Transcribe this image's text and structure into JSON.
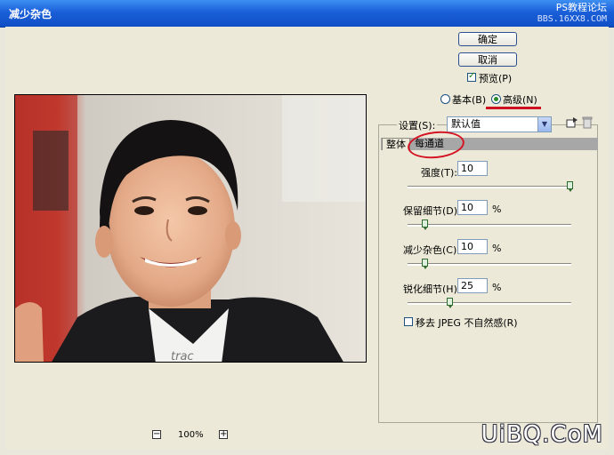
{
  "window": {
    "title": "减少杂色",
    "watermark_top_line1": "PS教程论坛",
    "watermark_top_line2": "BBS.16XX8.COM"
  },
  "buttons": {
    "ok": "确定",
    "cancel": "取消"
  },
  "preview": {
    "label": "预览(P)",
    "checked": true
  },
  "mode": {
    "basic_label": "基本(B)",
    "advanced_label": "高级(N)",
    "selected": "advanced"
  },
  "settings": {
    "label": "设置(S):",
    "value": "默认值"
  },
  "tabs": [
    {
      "label": "整体"
    },
    {
      "label": "每通道"
    }
  ],
  "controls": {
    "strength": {
      "label": "强度(T):",
      "value": "10",
      "level_fraction": 1.0
    },
    "preserve_details": {
      "label": "保留细节(D):",
      "value": "10",
      "unit": "%",
      "level_fraction": 0.1
    },
    "reduce_color_noise": {
      "label": "减少杂色(C):",
      "value": "10",
      "unit": "%",
      "level_fraction": 0.1
    },
    "sharpen_details": {
      "label": "锐化细节(H):",
      "value": "25",
      "unit": "%",
      "level_fraction": 0.25
    },
    "remove_jpeg": {
      "label": "移去 JPEG 不自然感(R)",
      "checked": false
    }
  },
  "preview_pane": {
    "zoom": "100%",
    "shirt_text": "trac"
  },
  "watermark_bottom": "UiBQ.CoM",
  "colors": {
    "title_bar": "#1a5fd8",
    "annotation_red": "#cc1020",
    "dialog_bg": "#ece9d8"
  },
  "icons": [
    "save-settings-icon",
    "delete-settings-icon",
    "zoom-out-icon",
    "zoom-in-icon",
    "dropdown-arrow-icon"
  ]
}
